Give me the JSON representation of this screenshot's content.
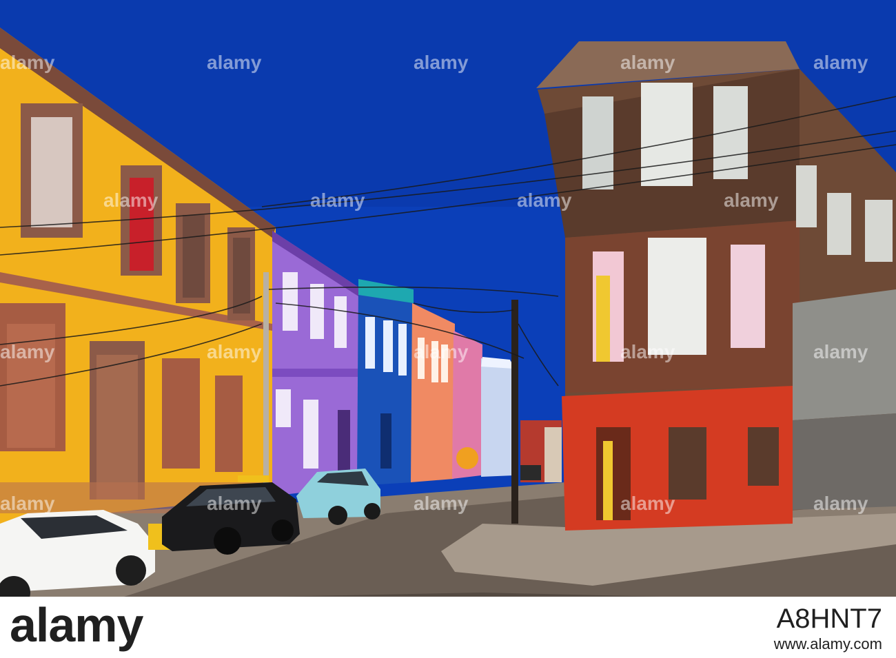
{
  "watermark": {
    "text": "alamy"
  },
  "footer": {
    "logo": "alamy",
    "image_id": "A8HNT7",
    "url": "www.alamy.com"
  },
  "scene": {
    "sky_color": "#0b3fb8",
    "building_colors": [
      "#f2b11c",
      "#9a6ad6",
      "#1a52b8",
      "#f08a63",
      "#e07aa8",
      "#c8d6f0",
      "#d43b22",
      "#6e4a36"
    ],
    "cars": [
      "white-sedan",
      "black-taxi",
      "light-blue-hatchback"
    ]
  }
}
